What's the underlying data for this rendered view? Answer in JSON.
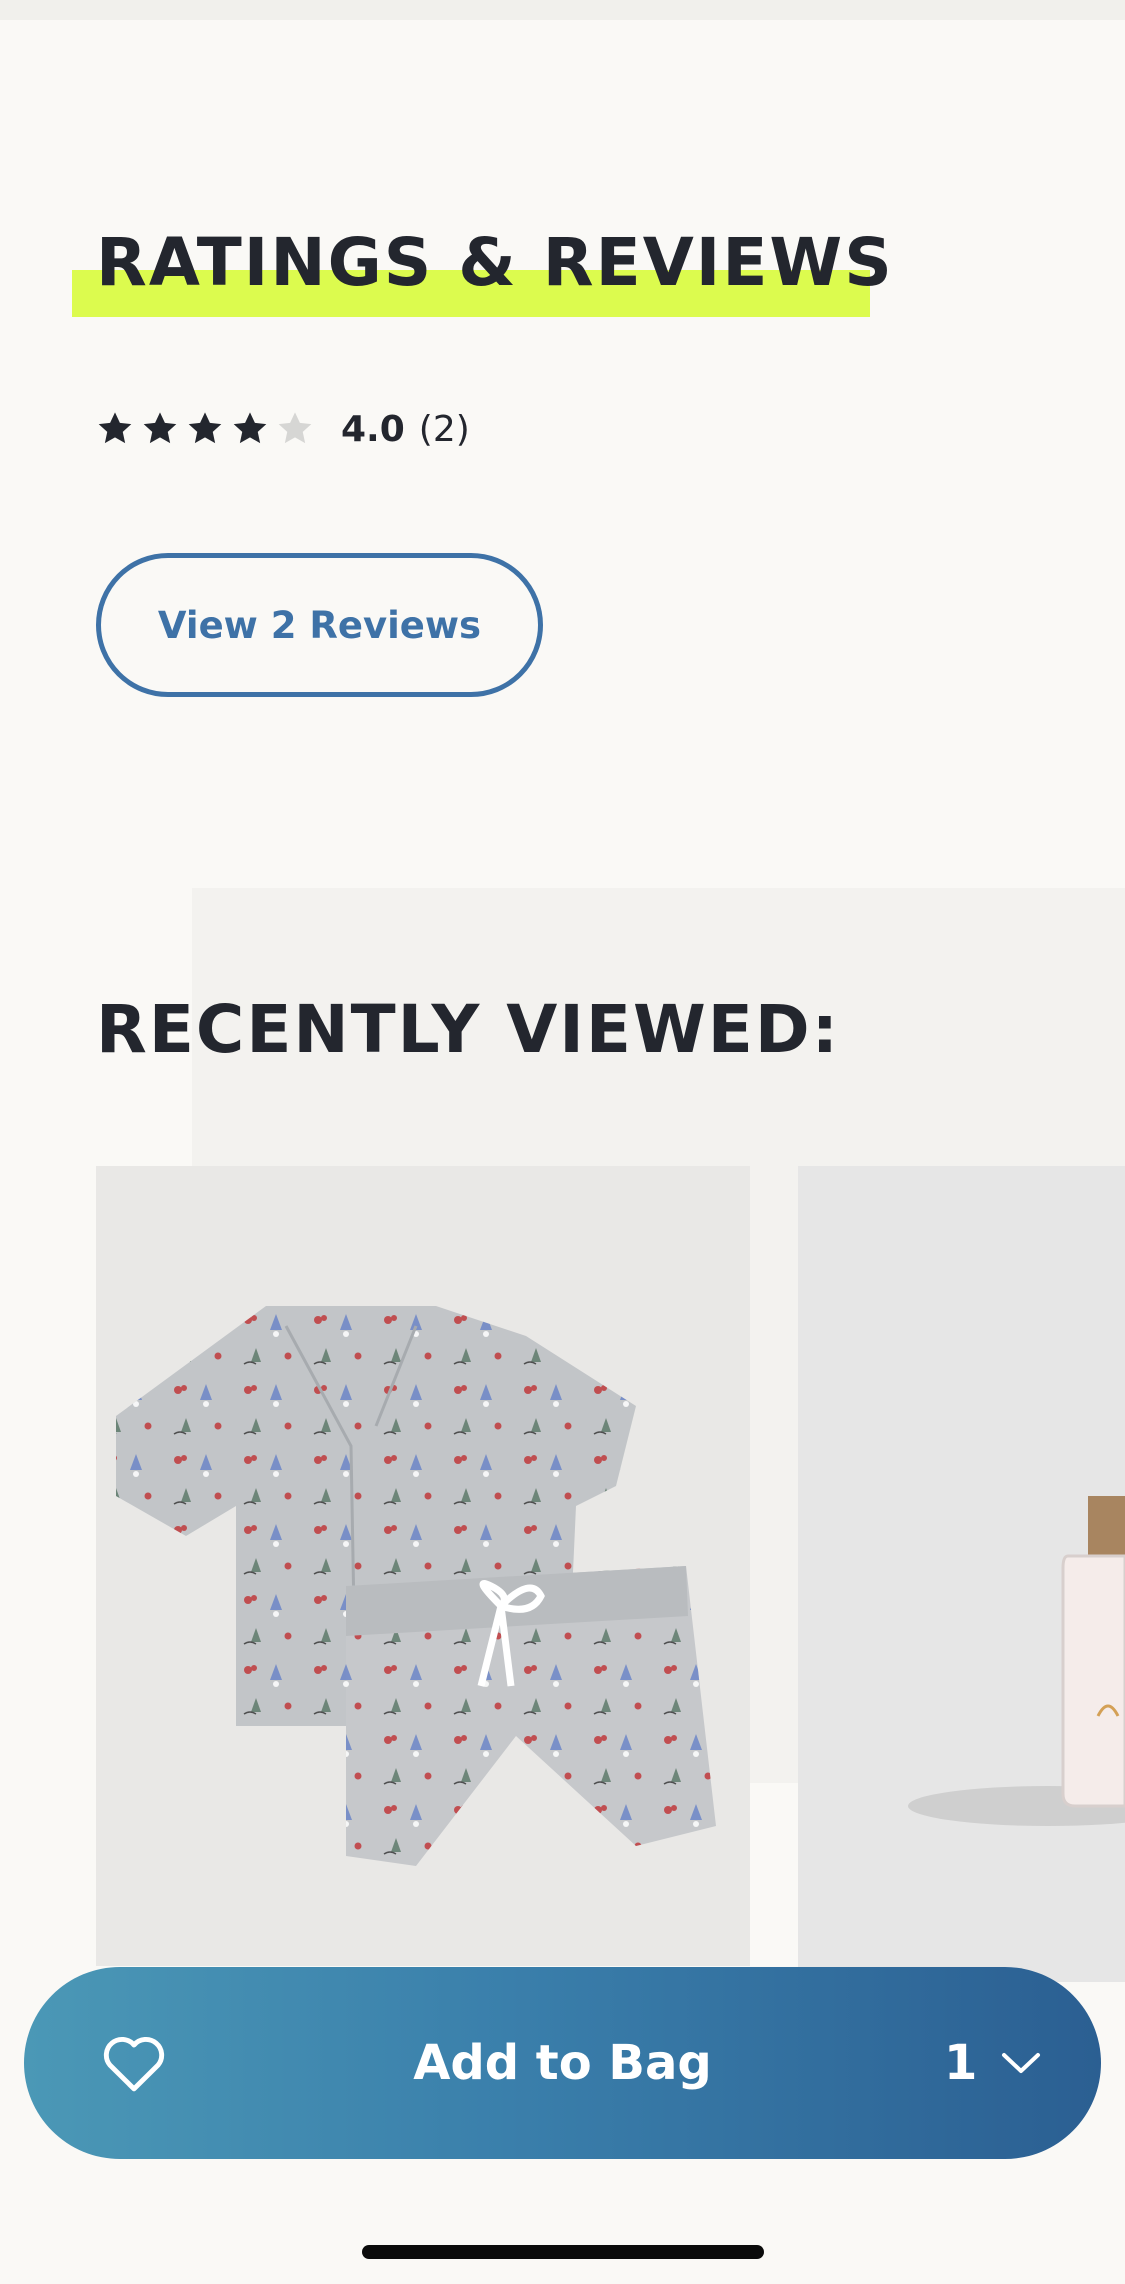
{
  "ratings": {
    "heading": "RATINGS & REVIEWS",
    "rating_value": "4.0",
    "rating_count": "(2)",
    "stars_filled": 4,
    "stars_total": 5,
    "view_reviews_label": "View 2 Reviews"
  },
  "recently_viewed": {
    "heading": "RECENTLY VIEWED:",
    "items": [
      {
        "image": "pajama-set-gnome-print"
      },
      {
        "image": "fragrance-bottle"
      }
    ]
  },
  "bag_bar": {
    "favorite_icon": "heart-icon",
    "add_label": "Add to Bag",
    "quantity": "1",
    "quantity_icon": "chevron-down-icon"
  },
  "colors": {
    "highlight": "#dcfb4e",
    "accent": "#3e72a7",
    "text": "#23262e",
    "bar_gradient_start": "#4b98b6",
    "bar_gradient_end": "#2b5f92"
  }
}
